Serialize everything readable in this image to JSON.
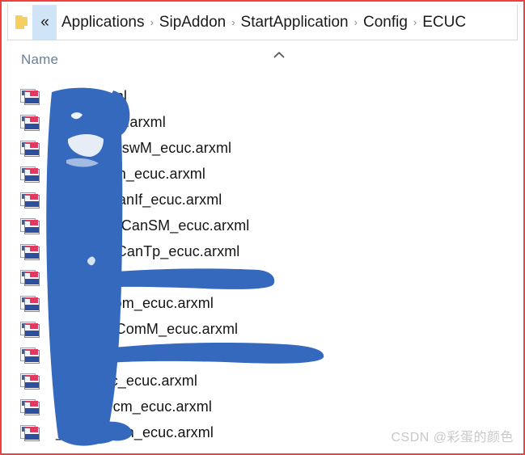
{
  "window": {
    "border_color": "#f04040",
    "background": "#ffffff"
  },
  "breadcrumb": {
    "folder_icon": "folder-icon",
    "overflow_label": "«",
    "separator": "›",
    "items": [
      {
        "label": "Applications"
      },
      {
        "label": "SipAddon"
      },
      {
        "label": "StartApplication"
      },
      {
        "label": "Config"
      },
      {
        "label": "ECUC"
      }
    ]
  },
  "list": {
    "column_header": "Name",
    "sort_direction": "ascending",
    "sort_icon": "chevron-up-icon",
    "file_icon": "xml-file-icon",
    "rows": [
      {
        "name": "ecuc.arxml",
        "redacted": false
      },
      {
        "name": "ecuc.Initial.arxml",
        "redacted": false
      },
      {
        "name": "_BswM_BswM_ecuc.arxml",
        "redacted": false
      },
      {
        "name": "_Can_Can_ecuc.arxml",
        "redacted": false
      },
      {
        "name": "_CanIf_CanIf_ecuc.arxml",
        "redacted": false
      },
      {
        "name": "_CanSM_CanSM_ecuc.arxml",
        "redacted": false
      },
      {
        "name": "_CanTp_CanTp_ecuc.arxml",
        "redacted": false
      },
      {
        "name": "",
        "redacted": true
      },
      {
        "name": "_Com_Com_ecuc.arxml",
        "redacted": false
      },
      {
        "name": "_ComM_ComM_ecuc.arxml",
        "redacted": false
      },
      {
        "name": "",
        "redacted": true
      },
      {
        "name": "_Crc_Crc_ecuc.arxml",
        "redacted": false
      },
      {
        "name": "_Dcm_Dcm_ecuc.arxml",
        "redacted": false
      },
      {
        "name": "_Dem_Dem_ecuc.arxml",
        "redacted": false
      }
    ]
  },
  "annotation": {
    "type": "hand-drawn-redaction",
    "color": "#3469be"
  },
  "watermark": {
    "text": "CSDN @彩蛋的颜色",
    "color": "#c8c8c8"
  }
}
